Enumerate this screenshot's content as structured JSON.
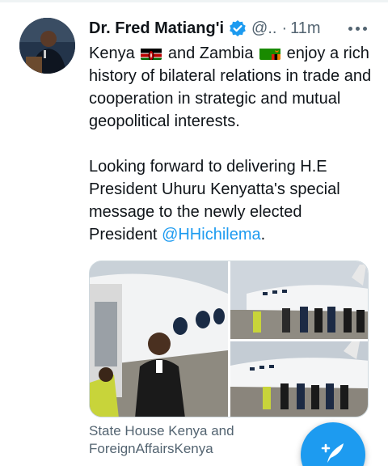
{
  "tweet": {
    "display_name": "Dr. Fred Matiang'i",
    "handle": "@..",
    "separator": "·",
    "time": "11m",
    "body": {
      "p1_a": "Kenya",
      "p1_b": "and Zambia",
      "p1_c": "enjoy a rich history of bilateral relations in trade and cooperation in strategic and mutual geopolitical interests.",
      "p2_a": "Looking forward to delivering H.E President Uhuru Kenyatta's special message to the newly elected President",
      "mention": "@HHichilema",
      "p2_end": "."
    },
    "flags": [
      "kenya-flag",
      "zambia-flag"
    ],
    "media_credit": "State House Kenya and ForeignAffairsKenya"
  },
  "icons": {
    "verified": "verified-badge-icon",
    "more": "more-options-icon",
    "compose": "compose-tweet-icon"
  },
  "colors": {
    "accent": "#1d9bf0",
    "text_primary": "#0f1419",
    "text_secondary": "#536471"
  }
}
